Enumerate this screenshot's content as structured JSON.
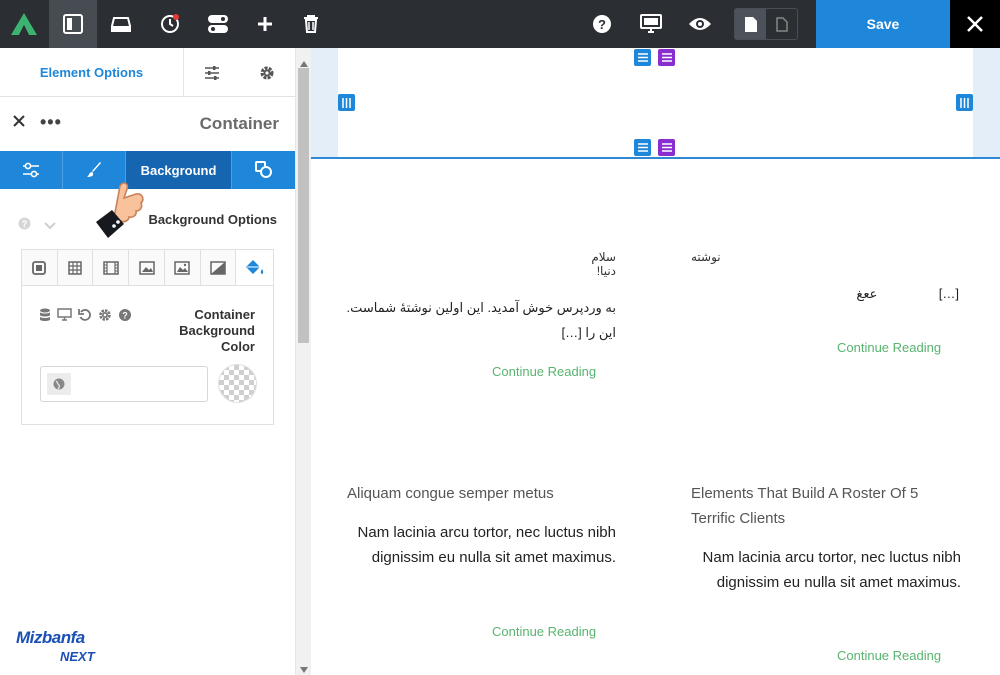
{
  "topbar": {
    "save_label": "Save",
    "icons": [
      "logo-icon",
      "layout-icon",
      "responsive-icon",
      "history-icon",
      "toggle-icon",
      "add-icon",
      "trash-icon",
      "help-icon",
      "desktop-icon",
      "preview-icon",
      "page-icon",
      "page-outline-icon",
      "close-icon"
    ]
  },
  "panel": {
    "tab_label": "Element Options",
    "element_title": "Container",
    "subtabs": {
      "background": "Background"
    },
    "background_options_label": "Background Options",
    "color_field_label": "Container Background Color"
  },
  "brand": {
    "line1": "Mizbanfa",
    "line2": "NEXT"
  },
  "posts": [
    {
      "title": "سلام دنیا!",
      "excerpt": "به وردپرس خوش آمدید. این اولین نوشتهٔ شماست. این را […]",
      "read_more": "Continue Reading"
    },
    {
      "title": "نوشته",
      "excerpt": "[…]                 ععغ",
      "read_more": "Continue Reading"
    },
    {
      "title": "Aliquam congue semper metus",
      "excerpt": "Nam lacinia arcu tortor, nec luctus nibh dignissim eu nulla sit amet maximus.",
      "read_more": "Continue Reading"
    },
    {
      "title": "Elements That Build A Roster Of 5 Terrific Clients",
      "excerpt": "Nam lacinia arcu tortor, nec luctus nibh dignissim eu nulla sit amet maximus.",
      "read_more": "Continue Reading"
    }
  ],
  "colors": {
    "accent": "#1e87d9",
    "dark": "#2b2e33",
    "purple": "#8a2ed0",
    "read_more": "#58b46f"
  }
}
